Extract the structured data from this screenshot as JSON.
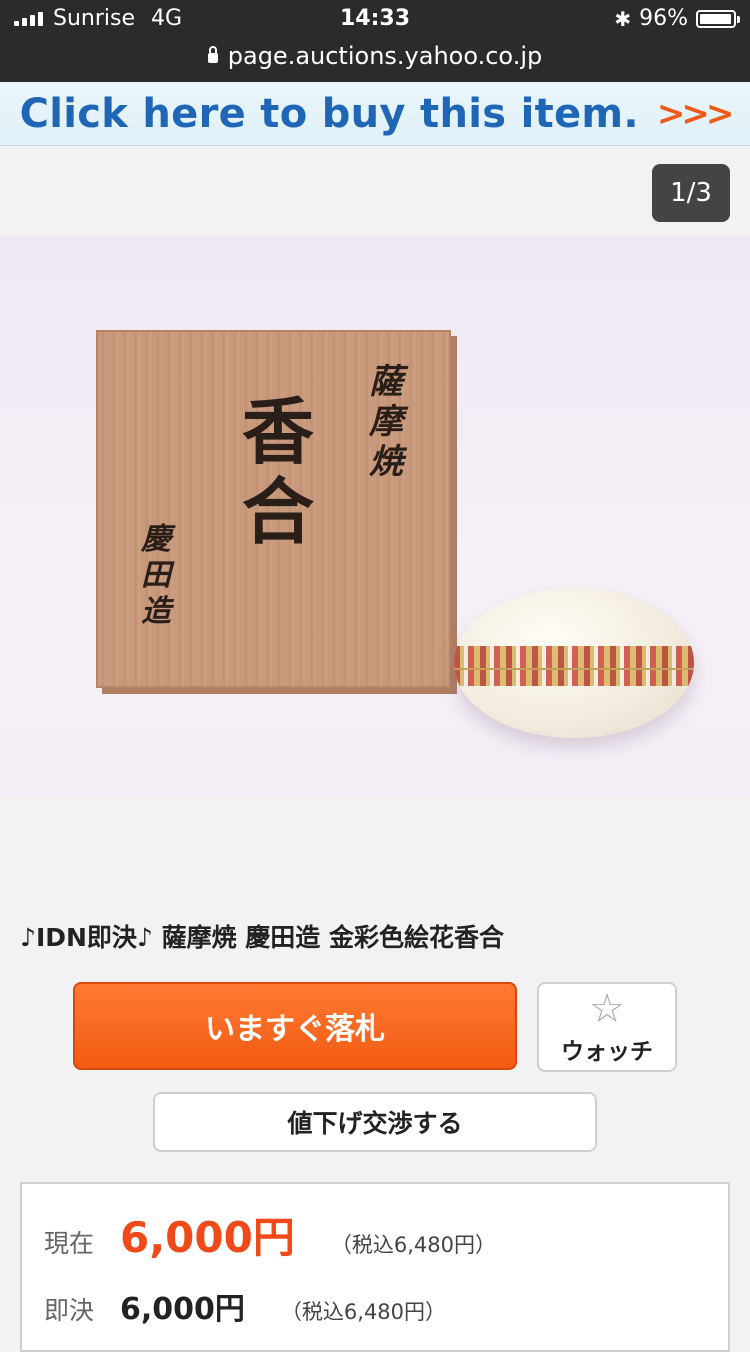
{
  "status_bar": {
    "carrier": "Sunrise",
    "network": "4G",
    "time": "14:33",
    "battery": "96%",
    "battery_level": 0.96,
    "url": "page.auctions.yahoo.co.jp"
  },
  "banner": {
    "text": "Click here to buy this item.",
    "chevrons": ">>>"
  },
  "gallery": {
    "counter": "1/3",
    "box_kanji_main": "香合",
    "box_kanji_right": "薩摩焼",
    "box_kanji_left": "慶田造"
  },
  "product": {
    "title": "♪IDN即決♪ 薩摩焼 慶田造 金彩色絵花香合",
    "buy_now_label": "いますぐ落札",
    "watch_label": "ウォッチ",
    "negotiate_label": "値下げ交渉する"
  },
  "price": {
    "current_label": "現在",
    "current_value": "6,000円",
    "current_tax": "（税込6,480円）",
    "buyout_label": "即決",
    "buyout_value": "6,000円",
    "buyout_tax": "（税込6,480円）"
  },
  "colors": {
    "accent_orange": "#f35b12",
    "banner_blue": "#1f66b6",
    "price_red": "#f0491a"
  }
}
